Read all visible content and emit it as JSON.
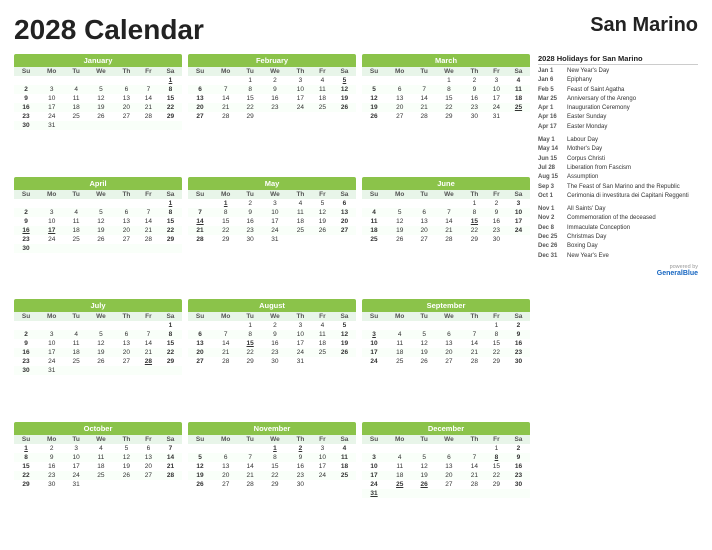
{
  "title": "2028 Calendar",
  "country": "San Marino",
  "holidays_title": "2028 Holidays for San Marino",
  "holidays": [
    {
      "date": "Jan 1",
      "name": "New Year's Day"
    },
    {
      "date": "Jan 6",
      "name": "Epiphany"
    },
    {
      "date": "Feb 5",
      "name": "Feast of Saint Agatha"
    },
    {
      "date": "Mar 25",
      "name": "Anniversary of the Arengo"
    },
    {
      "date": "Apr 1",
      "name": "Inauguration Ceremony"
    },
    {
      "date": "Apr 16",
      "name": "Easter Sunday"
    },
    {
      "date": "Apr 17",
      "name": "Easter Monday"
    },
    {
      "date": "gap",
      "name": ""
    },
    {
      "date": "May 1",
      "name": "Labour Day"
    },
    {
      "date": "May 14",
      "name": "Mother's Day"
    },
    {
      "date": "Jun 15",
      "name": "Corpus Christi"
    },
    {
      "date": "Jul 28",
      "name": "Liberation from Fascism"
    },
    {
      "date": "Aug 15",
      "name": "Assumption"
    },
    {
      "date": "Sep 3",
      "name": "The Feast of San Marino and the Republic"
    },
    {
      "date": "Oct 1",
      "name": "Cerimonia di investitura dei Capitani Reggenti"
    },
    {
      "date": "gap",
      "name": ""
    },
    {
      "date": "Nov 1",
      "name": "All Saints' Day"
    },
    {
      "date": "Nov 2",
      "name": "Commemoration of the deceased"
    },
    {
      "date": "Dec 8",
      "name": "Immaculate Conception"
    },
    {
      "date": "Dec 25",
      "name": "Christmas Day"
    },
    {
      "date": "Dec 26",
      "name": "Boxing Day"
    },
    {
      "date": "Dec 31",
      "name": "New Year's Eve"
    }
  ],
  "powered_by": "powered by",
  "brand": "GeneralBlue",
  "months": [
    {
      "name": "January",
      "weeks": [
        [
          "",
          "",
          "",
          "",
          "",
          "",
          "1"
        ],
        [
          "2",
          "3",
          "4",
          "5",
          "6",
          "7",
          "8"
        ],
        [
          "9",
          "10",
          "11",
          "12",
          "13",
          "14",
          "15"
        ],
        [
          "16",
          "17",
          "18",
          "19",
          "20",
          "21",
          "22"
        ],
        [
          "23",
          "24",
          "25",
          "26",
          "27",
          "28",
          "29"
        ],
        [
          "30",
          "31",
          "",
          "",
          "",
          "",
          ""
        ]
      ],
      "holidays": [
        "1"
      ],
      "saturdays": [
        "1",
        "8",
        "15",
        "22",
        "29"
      ]
    },
    {
      "name": "February",
      "weeks": [
        [
          "",
          "",
          "1",
          "2",
          "3",
          "4",
          "5"
        ],
        [
          "6",
          "7",
          "8",
          "9",
          "10",
          "11",
          "12"
        ],
        [
          "13",
          "14",
          "15",
          "16",
          "17",
          "18",
          "19"
        ],
        [
          "20",
          "21",
          "22",
          "23",
          "24",
          "25",
          "26"
        ],
        [
          "27",
          "28",
          "29",
          "",
          "",
          "",
          ""
        ]
      ],
      "holidays": [
        "5"
      ],
      "saturdays": [
        "5",
        "12",
        "19",
        "26"
      ]
    },
    {
      "name": "March",
      "weeks": [
        [
          "",
          "",
          "",
          "1",
          "2",
          "3",
          "4"
        ],
        [
          "5",
          "6",
          "7",
          "8",
          "9",
          "10",
          "11"
        ],
        [
          "12",
          "13",
          "14",
          "15",
          "16",
          "17",
          "18"
        ],
        [
          "19",
          "20",
          "21",
          "22",
          "23",
          "24",
          "25"
        ],
        [
          "26",
          "27",
          "28",
          "29",
          "30",
          "31",
          ""
        ]
      ],
      "holidays": [
        "25"
      ],
      "saturdays": [
        "4",
        "11",
        "18",
        "25"
      ]
    },
    {
      "name": "April",
      "weeks": [
        [
          "",
          "",
          "",
          "",
          "",
          "",
          "1"
        ],
        [
          "2",
          "3",
          "4",
          "5",
          "6",
          "7",
          "8"
        ],
        [
          "9",
          "10",
          "11",
          "12",
          "13",
          "14",
          "15"
        ],
        [
          "16",
          "17",
          "18",
          "19",
          "20",
          "21",
          "22"
        ],
        [
          "23",
          "24",
          "25",
          "26",
          "27",
          "28",
          "29"
        ],
        [
          "30",
          "",
          "",
          "",
          "",
          "",
          ""
        ]
      ],
      "holidays": [
        "1",
        "16",
        "17"
      ],
      "saturdays": [
        "1",
        "8",
        "15",
        "22",
        "29"
      ]
    },
    {
      "name": "May",
      "weeks": [
        [
          "",
          "1",
          "2",
          "3",
          "4",
          "5",
          "6"
        ],
        [
          "7",
          "8",
          "9",
          "10",
          "11",
          "12",
          "13"
        ],
        [
          "14",
          "15",
          "16",
          "17",
          "18",
          "19",
          "20"
        ],
        [
          "21",
          "22",
          "23",
          "24",
          "25",
          "26",
          "27"
        ],
        [
          "28",
          "29",
          "30",
          "31",
          "",
          "",
          ""
        ]
      ],
      "holidays": [
        "1",
        "14"
      ],
      "saturdays": [
        "6",
        "13",
        "20",
        "27"
      ]
    },
    {
      "name": "June",
      "weeks": [
        [
          "",
          "",
          "",
          "",
          "1",
          "2",
          "3"
        ],
        [
          "4",
          "5",
          "6",
          "7",
          "8",
          "9",
          "10"
        ],
        [
          "11",
          "12",
          "13",
          "14",
          "15",
          "16",
          "17"
        ],
        [
          "18",
          "19",
          "20",
          "21",
          "22",
          "23",
          "24"
        ],
        [
          "25",
          "26",
          "27",
          "28",
          "29",
          "30",
          ""
        ]
      ],
      "holidays": [
        "15"
      ],
      "saturdays": [
        "3",
        "10",
        "17",
        "24"
      ]
    },
    {
      "name": "July",
      "weeks": [
        [
          "",
          "",
          "",
          "",
          "",
          "",
          "1"
        ],
        [
          "2",
          "3",
          "4",
          "5",
          "6",
          "7",
          "8"
        ],
        [
          "9",
          "10",
          "11",
          "12",
          "13",
          "14",
          "15"
        ],
        [
          "16",
          "17",
          "18",
          "19",
          "20",
          "21",
          "22"
        ],
        [
          "23",
          "24",
          "25",
          "26",
          "27",
          "28",
          "29"
        ],
        [
          "30",
          "31",
          "",
          "",
          "",
          "",
          ""
        ]
      ],
      "holidays": [
        "28"
      ],
      "saturdays": [
        "1",
        "8",
        "15",
        "22",
        "29"
      ]
    },
    {
      "name": "August",
      "weeks": [
        [
          "",
          "",
          "1",
          "2",
          "3",
          "4",
          "5"
        ],
        [
          "6",
          "7",
          "8",
          "9",
          "10",
          "11",
          "12"
        ],
        [
          "13",
          "14",
          "15",
          "16",
          "17",
          "18",
          "19"
        ],
        [
          "20",
          "21",
          "22",
          "23",
          "24",
          "25",
          "26"
        ],
        [
          "27",
          "28",
          "29",
          "30",
          "31",
          "",
          ""
        ]
      ],
      "holidays": [
        "15"
      ],
      "saturdays": [
        "5",
        "12",
        "19",
        "26"
      ]
    },
    {
      "name": "September",
      "weeks": [
        [
          "",
          "",
          "",
          "",
          "",
          "1",
          "2"
        ],
        [
          "3",
          "4",
          "5",
          "6",
          "7",
          "8",
          "9"
        ],
        [
          "10",
          "11",
          "12",
          "13",
          "14",
          "15",
          "16"
        ],
        [
          "17",
          "18",
          "19",
          "20",
          "21",
          "22",
          "23"
        ],
        [
          "24",
          "25",
          "26",
          "27",
          "28",
          "29",
          "30"
        ]
      ],
      "holidays": [
        "3"
      ],
      "saturdays": [
        "2",
        "9",
        "16",
        "23",
        "30"
      ]
    },
    {
      "name": "October",
      "weeks": [
        [
          "1",
          "2",
          "3",
          "4",
          "5",
          "6",
          "7"
        ],
        [
          "8",
          "9",
          "10",
          "11",
          "12",
          "13",
          "14"
        ],
        [
          "15",
          "16",
          "17",
          "18",
          "19",
          "20",
          "21"
        ],
        [
          "22",
          "23",
          "24",
          "25",
          "26",
          "27",
          "28"
        ],
        [
          "29",
          "30",
          "31",
          "",
          "",
          "",
          ""
        ]
      ],
      "holidays": [
        "1"
      ],
      "saturdays": [
        "7",
        "14",
        "21",
        "28"
      ]
    },
    {
      "name": "November",
      "weeks": [
        [
          "",
          "",
          "",
          "1",
          "2",
          "3",
          "4"
        ],
        [
          "5",
          "6",
          "7",
          "8",
          "9",
          "10",
          "11"
        ],
        [
          "12",
          "13",
          "14",
          "15",
          "16",
          "17",
          "18"
        ],
        [
          "19",
          "20",
          "21",
          "22",
          "23",
          "24",
          "25"
        ],
        [
          "26",
          "27",
          "28",
          "29",
          "30",
          "",
          ""
        ]
      ],
      "holidays": [
        "1",
        "2"
      ],
      "saturdays": [
        "4",
        "11",
        "18",
        "25"
      ]
    },
    {
      "name": "December",
      "weeks": [
        [
          "",
          "",
          "",
          "",
          "",
          "1",
          "2"
        ],
        [
          "3",
          "4",
          "5",
          "6",
          "7",
          "8",
          "9"
        ],
        [
          "10",
          "11",
          "12",
          "13",
          "14",
          "15",
          "16"
        ],
        [
          "17",
          "18",
          "19",
          "20",
          "21",
          "22",
          "23"
        ],
        [
          "24",
          "25",
          "26",
          "27",
          "28",
          "29",
          "30"
        ],
        [
          "31",
          "",
          "",
          "",
          "",
          "",
          ""
        ]
      ],
      "holidays": [
        "8",
        "25",
        "26",
        "31"
      ],
      "saturdays": [
        "2",
        "9",
        "16",
        "23",
        "30"
      ]
    }
  ]
}
